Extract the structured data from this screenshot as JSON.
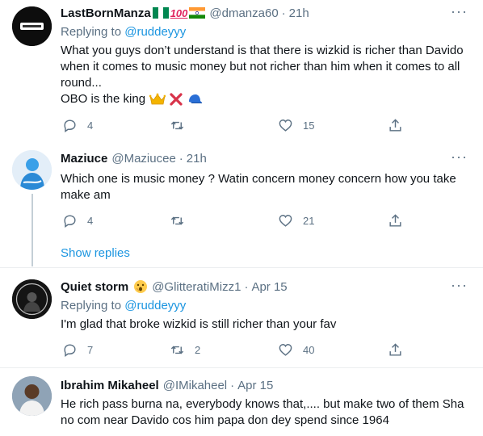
{
  "tweets": [
    {
      "name": "LastBornManza",
      "name_emojis": [
        "nigeria-flag",
        "hundred-points",
        "india-flag"
      ],
      "handle": "@dmanza60",
      "time": "21h",
      "replying_prefix": "Replying to",
      "replying_to": "@ruddeyyy",
      "text_lines": [
        "What you guys don’t understand is that there is wizkid is richer than Davido",
        "when it comes to music money but not richer than him when it comes to all",
        "round...",
        "OBO is the king"
      ],
      "text_emojis": [
        "crown",
        "cross-mark",
        "billed-cap"
      ],
      "replies": "4",
      "retweets": "",
      "likes": "15"
    },
    {
      "name": "Maziuce",
      "handle": "@Maziucee",
      "time": "21h",
      "text_lines": [
        "Which one is music money ? Watin concern money concern how you take",
        "make am"
      ],
      "replies": "4",
      "retweets": "",
      "likes": "21"
    },
    {
      "name": "Quiet storm",
      "name_emojis": [
        "hushed-face"
      ],
      "handle": "@GlitteratiMizz1",
      "time": "Apr 15",
      "replying_prefix": "Replying to",
      "replying_to": "@ruddeyyy",
      "text_lines": [
        "I'm glad that broke wizkid is still richer than your fav"
      ],
      "replies": "7",
      "retweets": "2",
      "likes": "40"
    },
    {
      "name": "Ibrahim Mikaheel",
      "handle": "@IMikaheel",
      "time": "Apr 15",
      "text_lines": [
        "He rich pass burna na, everybody knows that,.... but make two of them Sha",
        "no com near Davido cos him papa don dey spend since 1964"
      ]
    }
  ],
  "show_replies_label": "Show replies",
  "dot": "·",
  "colors": {
    "text": "#0f1419",
    "secondary": "#5b7083",
    "link": "#1b95e0",
    "border": "#ebeef0",
    "thread": "#c4cfd6"
  }
}
